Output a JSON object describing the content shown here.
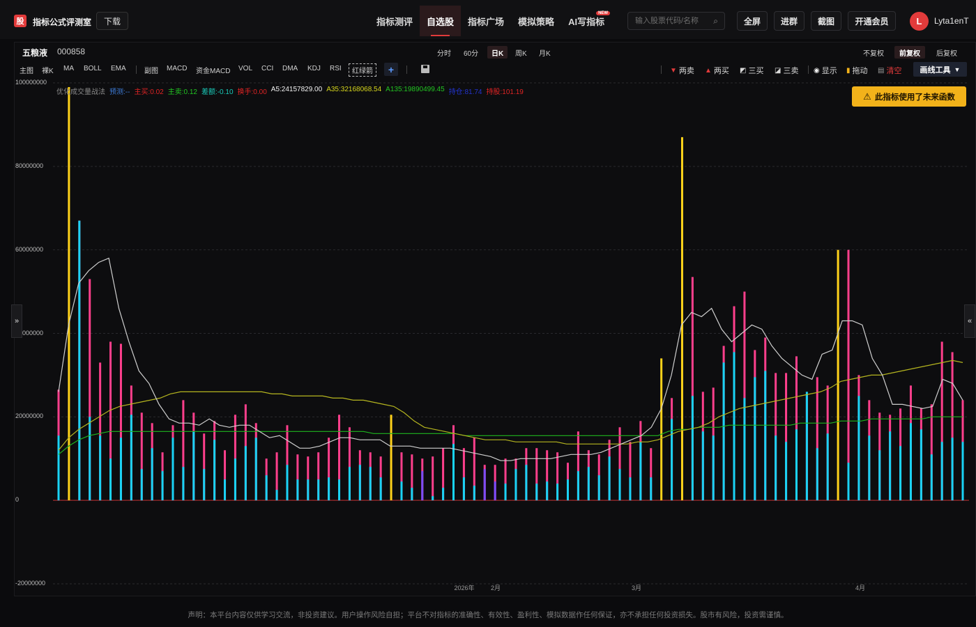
{
  "app": {
    "logo_char": "股",
    "title": "指标公式评测室",
    "download_label": "下载"
  },
  "nav": [
    {
      "label": "指标测评",
      "active": false
    },
    {
      "label": "自选股",
      "active": true
    },
    {
      "label": "指标广场",
      "active": false
    },
    {
      "label": "模拟策略",
      "active": false
    },
    {
      "label": "AI写指标",
      "active": false,
      "badge": "NEW"
    }
  ],
  "search": {
    "placeholder": "输入股票代码/名称"
  },
  "header_buttons": {
    "fullscreen": "全屏",
    "join_group": "进群",
    "screenshot": "截图",
    "vip": "开通会员"
  },
  "user": {
    "initial": "L",
    "name": "Lyta1enT"
  },
  "stock": {
    "name": "五粮液",
    "code": "000858"
  },
  "periods": [
    {
      "label": "分时",
      "active": false
    },
    {
      "label": "60分",
      "active": false
    },
    {
      "label": "日K",
      "active": true
    },
    {
      "label": "周K",
      "active": false
    },
    {
      "label": "月K",
      "active": false
    }
  ],
  "adjust": [
    {
      "label": "不复权",
      "active": false
    },
    {
      "label": "前复权",
      "active": true
    },
    {
      "label": "后复权",
      "active": false
    }
  ],
  "indicators_main": [
    "主图",
    "裸K",
    "MA",
    "BOLL",
    "EMA"
  ],
  "indicators_sub": [
    "副图",
    "MACD",
    "资金MACD",
    "VOL",
    "CCI",
    "DMA",
    "KDJ",
    "RSI",
    "红绿箭"
  ],
  "tools": {
    "two_sell": "两卖",
    "two_buy": "两买",
    "three_buy": "三买",
    "three_sell": "三卖",
    "show": "显示",
    "drag": "拖动",
    "clear": "清空",
    "draw_tools": "画线工具"
  },
  "warning": "此指标使用了未来函数",
  "legend": [
    {
      "text": "优化成交量战法",
      "color": "#8a8a8a"
    },
    {
      "text": "预测:--",
      "color": "#3d7bd6"
    },
    {
      "text": "主买:0.02",
      "color": "#e02424"
    },
    {
      "text": "主卖:0.12",
      "color": "#22c522"
    },
    {
      "text": "差额:-0.10",
      "color": "#19c9b8"
    },
    {
      "text": "换手:0.00",
      "color": "#e02424"
    },
    {
      "text": "A5:24157829.00",
      "color": "#f2f2f2"
    },
    {
      "text": "A35:32168068.54",
      "color": "#d6d61c"
    },
    {
      "text": "A135:19890499.45",
      "color": "#22c522"
    },
    {
      "text": "持仓:81.74",
      "color": "#2233cc"
    },
    {
      "text": "持股:101.19",
      "color": "#e02424"
    }
  ],
  "disclaimer": "声明：本平台内容仅供学习交流，非投资建议。用户操作风险自担；平台不对指标的准确性、有效性、盈利性、模拟数据作任何保证，亦不承担任何投资损失。股市有风险，投资需谨慎。",
  "chart_data": {
    "type": "bar",
    "ylim": [
      -20000000,
      100000000
    ],
    "y_ticks": [
      "100000000",
      "80000000",
      "60000000",
      "40000000",
      "20000000",
      "0",
      "-20000000"
    ],
    "x_labels": [
      "2026年",
      "2月",
      "3月",
      "4月"
    ],
    "colors": {
      "total": "#ff3f8c",
      "part": "#19d3f5",
      "special": "#ffd21a",
      "purple": "#7b4dff",
      "a5": "#cfcfcf",
      "a35": "#b5b51f",
      "a135": "#1fb51f"
    },
    "bars": [
      {
        "t": 26.5,
        "p": 15.5
      },
      {
        "t": 99,
        "p": 0,
        "s": 1
      },
      {
        "t": 67,
        "p": 67
      },
      {
        "t": 53,
        "p": 20
      },
      {
        "t": 33,
        "p": 15.5
      },
      {
        "t": 38,
        "p": 10
      },
      {
        "t": 37.5,
        "p": 15
      },
      {
        "t": 27.5,
        "p": 20.5
      },
      {
        "t": 21,
        "p": 7.5
      },
      {
        "t": 18.5,
        "p": 12.5
      },
      {
        "t": 11.5,
        "p": 7
      },
      {
        "t": 18,
        "p": 15
      },
      {
        "t": 24,
        "p": 8
      },
      {
        "t": 21,
        "p": 16.5
      },
      {
        "t": 16,
        "p": 7.5
      },
      {
        "t": 19,
        "p": 14.5
      },
      {
        "t": 12,
        "p": 5
      },
      {
        "t": 20.5,
        "p": 10
      },
      {
        "t": 23,
        "p": 13
      },
      {
        "t": 18.5,
        "p": 15
      },
      {
        "t": 10,
        "p": 6
      },
      {
        "t": 11.5,
        "p": 2.5
      },
      {
        "t": 18,
        "p": 8.5
      },
      {
        "t": 11,
        "p": 5
      },
      {
        "t": 10.5,
        "p": 5
      },
      {
        "t": 11.5,
        "p": 5
      },
      {
        "t": 15,
        "p": 5.5
      },
      {
        "t": 20.5,
        "p": 5
      },
      {
        "t": 17.5,
        "p": 8
      },
      {
        "t": 12,
        "p": 8.5
      },
      {
        "t": 11.5,
        "p": 8
      },
      {
        "t": 10.5,
        "p": 5.5
      },
      {
        "t": 20.5,
        "p": 0,
        "s": 1
      },
      {
        "t": 11.5,
        "p": 4.5
      },
      {
        "t": 11,
        "p": 3
      },
      {
        "t": 10,
        "p": 7,
        "v": 1
      },
      {
        "t": 10.5,
        "p": 1
      },
      {
        "t": 12.5,
        "p": 3
      },
      {
        "t": 18,
        "p": 13.5
      },
      {
        "t": 12.5,
        "p": 5.5
      },
      {
        "t": 15,
        "p": 3.5
      },
      {
        "t": 8.5,
        "p": 7.5,
        "v": 1
      },
      {
        "t": 8.5,
        "p": 4.5,
        "v": 1
      },
      {
        "t": 10,
        "p": 4
      },
      {
        "t": 10,
        "p": 7.5
      },
      {
        "t": 12.5,
        "p": 8.5
      },
      {
        "t": 12.5,
        "p": 4
      },
      {
        "t": 12,
        "p": 4.5
      },
      {
        "t": 11.5,
        "p": 4
      },
      {
        "t": 9,
        "p": 5
      },
      {
        "t": 16.5,
        "p": 7
      },
      {
        "t": 12,
        "p": 8
      },
      {
        "t": 11,
        "p": 6
      },
      {
        "t": 14.5,
        "p": 10.5
      },
      {
        "t": 17.5,
        "p": 7.5
      },
      {
        "t": 14,
        "p": 5.5
      },
      {
        "t": 19,
        "p": 14
      },
      {
        "t": 12.5,
        "p": 5.5
      },
      {
        "t": 34,
        "p": 0,
        "s": 1
      },
      {
        "t": 24.5,
        "p": 19.5
      },
      {
        "t": 87,
        "p": 0,
        "s": 1
      },
      {
        "t": 53.5,
        "p": 25
      },
      {
        "t": 26,
        "p": 16.5
      },
      {
        "t": 27,
        "p": 15.5
      },
      {
        "t": 37,
        "p": 33
      },
      {
        "t": 46.5,
        "p": 35.5
      },
      {
        "t": 50,
        "p": 24.5
      },
      {
        "t": 36,
        "p": 29.5
      },
      {
        "t": 39,
        "p": 31
      },
      {
        "t": 30.5,
        "p": 15.5
      },
      {
        "t": 30.5,
        "p": 14
      },
      {
        "t": 34.5,
        "p": 17
      },
      {
        "t": 25.5,
        "p": 26
      },
      {
        "t": 29.5,
        "p": 12.5
      },
      {
        "t": 27.5,
        "p": 16
      },
      {
        "t": 60,
        "p": 0,
        "s": 1
      },
      {
        "t": 60,
        "p": 9
      },
      {
        "t": 30,
        "p": 25
      },
      {
        "t": 24,
        "p": 15.5
      },
      {
        "t": 21,
        "p": 12
      },
      {
        "t": 20.5,
        "p": 16.5
      },
      {
        "t": 22,
        "p": 13
      },
      {
        "t": 27.5,
        "p": 18.5
      },
      {
        "t": 22,
        "p": 17
      },
      {
        "t": 23,
        "p": 11
      },
      {
        "t": 38,
        "p": 14
      },
      {
        "t": 35.5,
        "p": 15
      },
      {
        "t": 24,
        "p": 14
      }
    ],
    "a5": [
      26,
      42,
      52,
      55,
      57,
      58,
      46,
      38,
      31,
      28,
      23,
      19.5,
      18.5,
      18.5,
      18,
      19.5,
      18,
      17.5,
      18,
      18,
      16.5,
      15,
      15.5,
      14,
      12.5,
      12.5,
      13,
      14,
      15,
      15,
      14.5,
      14.5,
      14.5,
      13,
      13,
      13,
      12.5,
      12.5,
      12.5,
      12.5,
      12,
      11.5,
      11,
      10.5,
      9.5,
      9.5,
      10,
      10,
      10,
      10,
      10.5,
      11,
      11,
      11,
      11.5,
      12.5,
      13.5,
      14.5,
      15.5,
      17.5,
      22,
      30,
      42,
      45,
      44,
      46,
      41,
      38,
      40,
      42,
      41,
      37,
      34,
      32,
      30,
      29,
      35,
      36,
      43,
      43,
      42,
      34,
      30,
      23,
      23,
      22.5,
      22,
      22.5,
      29,
      28,
      24
    ],
    "a35": [
      12,
      15,
      17,
      18.5,
      20,
      21.5,
      22.5,
      23,
      23.5,
      24,
      24.5,
      25.5,
      26,
      26,
      26,
      26,
      26,
      26,
      26,
      26,
      26,
      25.5,
      25.5,
      25,
      25,
      25,
      25,
      24.5,
      24.5,
      24,
      24,
      23.5,
      23,
      22.5,
      21,
      19,
      17.5,
      17,
      16.5,
      16,
      15.5,
      15,
      14.5,
      14.5,
      14.5,
      14,
      14,
      14,
      14,
      14,
      13.5,
      13.5,
      13.5,
      13.5,
      13.5,
      13.5,
      13.5,
      14,
      14,
      14.5,
      15.5,
      16.5,
      17,
      17.5,
      18.5,
      20,
      21,
      22,
      22.5,
      23,
      23.5,
      24,
      24.5,
      25,
      25.5,
      26,
      27,
      28.5,
      29,
      29.5,
      30,
      30,
      30.5,
      31,
      31.5,
      32,
      32.5,
      33,
      33.5,
      33
    ],
    "a135": [
      11,
      13,
      14.5,
      15.5,
      16,
      16.5,
      16.5,
      16.5,
      16.5,
      16.5,
      16.5,
      16.5,
      16.5,
      16.5,
      16.5,
      16.5,
      16.5,
      16.5,
      16.5,
      16.5,
      16.5,
      16.5,
      16.5,
      16.5,
      16.5,
      16.5,
      16.5,
      16.5,
      16.5,
      16.5,
      16.5,
      16,
      16,
      16,
      16,
      16,
      16,
      16,
      16,
      16,
      15.5,
      15.5,
      15.5,
      15.5,
      15.5,
      15.5,
      15.5,
      15.5,
      15.5,
      15.5,
      15.5,
      15.5,
      15.5,
      15.5,
      15.5,
      15.5,
      15.5,
      15.5,
      15.5,
      15.5,
      16.5,
      17,
      17,
      17.5,
      17.5,
      17.5,
      18,
      18,
      18,
      18,
      18,
      18,
      18,
      18.5,
      18.5,
      18.5,
      18.5,
      19,
      19,
      19,
      19.5,
      19.5,
      19.5,
      19.5,
      19.5,
      19.5,
      20,
      20,
      20,
      20
    ]
  }
}
